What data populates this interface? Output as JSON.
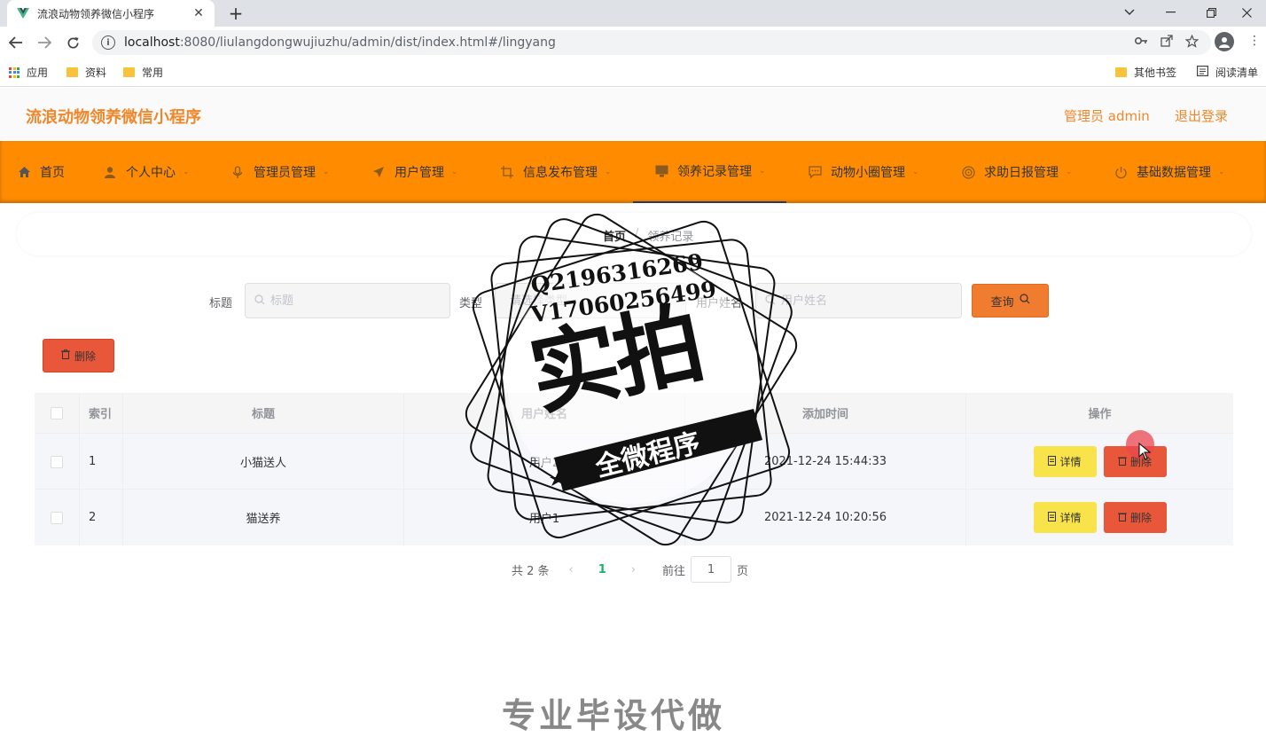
{
  "browser": {
    "tab_title": "流浪动物领养微信小程序",
    "url_host": "localhost",
    "url_rest": ":8080/liulangdongwujiuzhu/admin/dist/index.html#/lingyang",
    "bookmarks": [
      "应用",
      "资料",
      "常用"
    ],
    "bookmarks_right": [
      "其他书签",
      "阅读清单"
    ]
  },
  "header": {
    "app_title": "流浪动物领养微信小程序",
    "admin_label": "管理员 admin",
    "logout_label": "退出登录"
  },
  "nav": {
    "items": [
      {
        "label": "首页",
        "icon": "home-icon"
      },
      {
        "label": "个人中心",
        "icon": "user-icon"
      },
      {
        "label": "管理员管理",
        "icon": "mic-icon"
      },
      {
        "label": "用户管理",
        "icon": "send-icon"
      },
      {
        "label": "信息发布管理",
        "icon": "crop-icon"
      },
      {
        "label": "领养记录管理",
        "icon": "monitor-icon"
      },
      {
        "label": "动物小圈管理",
        "icon": "chat-icon"
      },
      {
        "label": "求助日报管理",
        "icon": "target-icon"
      },
      {
        "label": "基础数据管理",
        "icon": "power-icon"
      }
    ]
  },
  "breadcrumb": {
    "home": "首页",
    "sep": "/",
    "current": "领养记录"
  },
  "search": {
    "title_label": "标题",
    "title_placeholder": "标题",
    "type_label": "类型",
    "type_placeholder": "请选择类型",
    "username_label": "用户姓名",
    "username_placeholder": "用户姓名",
    "query_label": "查询"
  },
  "actions": {
    "batch_delete_label": "删除"
  },
  "table": {
    "headers": [
      "索引",
      "标题",
      "用户姓名",
      "添加时间",
      "操作"
    ],
    "rows": [
      {
        "index": "1",
        "title": "小猫送人",
        "username": "用户2",
        "time": "2021-12-24 15:44:33"
      },
      {
        "index": "2",
        "title": "猫送养",
        "username": "用户1",
        "time": "2021-12-24 10:20:56"
      }
    ],
    "detail_label": "详情",
    "delete_label": "删除"
  },
  "pagination": {
    "total": "共 2 条",
    "current_page": "1",
    "goto_label": "前往",
    "goto_value": "1",
    "page_suffix": "页"
  },
  "watermark": {
    "line1": "Q2196316269",
    "line2": "V17060256499",
    "big": "实拍",
    "banner": "全微程序",
    "bottom": "专业毕设代做"
  },
  "colors": {
    "nav_bg": "#ff8c00",
    "accent_text": "#f0882b",
    "delete": "#e8573a",
    "detail": "#f8e34a",
    "query": "#f07c2f",
    "page_active": "#18b566"
  }
}
